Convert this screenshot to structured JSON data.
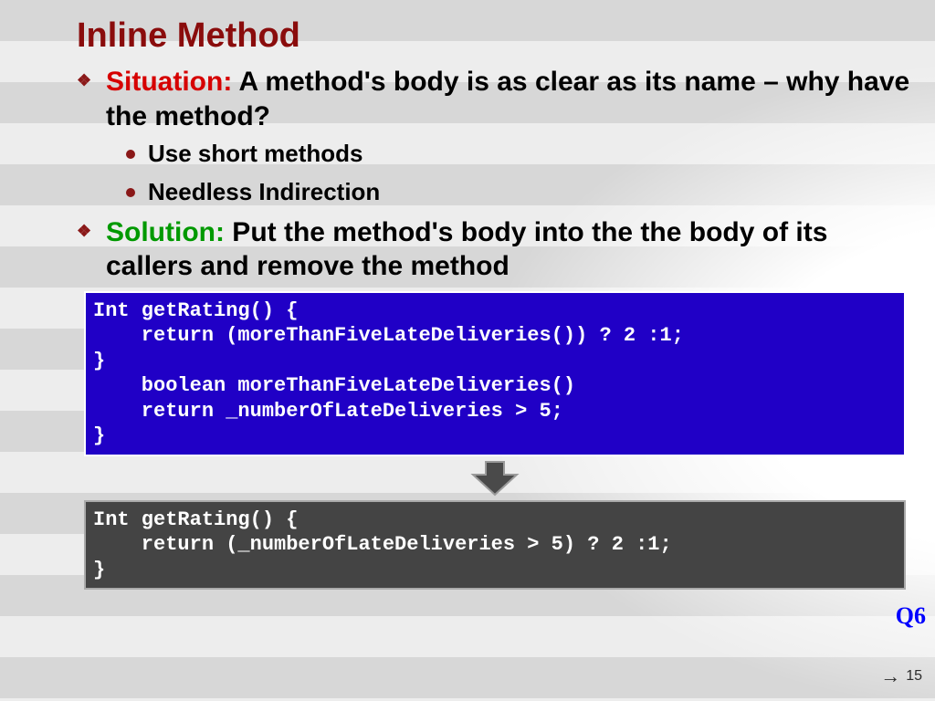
{
  "title": "Inline Method",
  "bullets": {
    "situation_label": "Situation:",
    "situation_text": " A method's body is as clear as its name – why have the method?",
    "sub1": "Use short methods",
    "sub2": "Needless Indirection",
    "solution_label": "Solution:",
    "solution_text": " Put the method's body into the the body of its callers and remove the method"
  },
  "code_before": "Int getRating() {\n    return (moreThanFiveLateDeliveries()) ? 2 :1;\n}\n    boolean moreThanFiveLateDeliveries()\n    return _numberOfLateDeliveries > 5;\n}",
  "code_after": "Int getRating() {\n    return (_numberOfLateDeliveries > 5) ? 2 :1;\n}",
  "q_label": "Q6",
  "page_num": "15"
}
